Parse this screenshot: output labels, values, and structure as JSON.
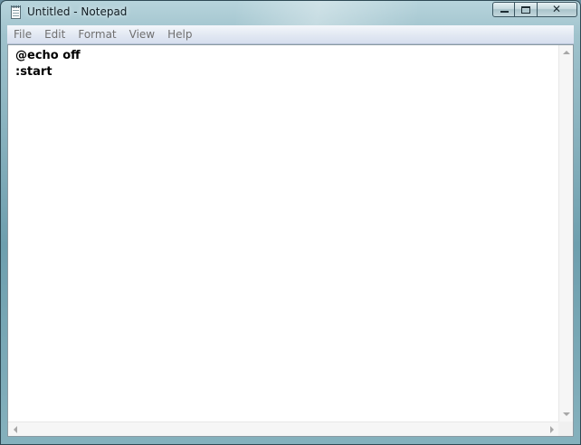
{
  "window": {
    "title": "Untitled - Notepad",
    "icon": "notepad-icon"
  },
  "caption_buttons": {
    "minimize": "minimize-icon",
    "maximize": "maximize-icon",
    "close_glyph": "✕"
  },
  "menu": {
    "items": [
      {
        "label": "File"
      },
      {
        "label": "Edit"
      },
      {
        "label": "Format"
      },
      {
        "label": "View"
      },
      {
        "label": "Help"
      }
    ]
  },
  "editor": {
    "lines": [
      "@echo off",
      ":start"
    ]
  },
  "colors": {
    "menu_text": "#707070",
    "editor_background": "#ffffff",
    "frame_accent": "#6e9fae"
  }
}
